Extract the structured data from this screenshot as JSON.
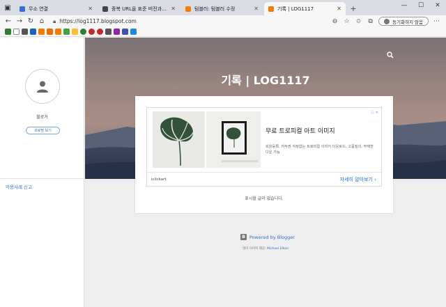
{
  "browser": {
    "tabs": [
      {
        "title": "무소 연결",
        "favicon_color": "#2f6fd6",
        "active": false
      },
      {
        "title": "중복 URL을 표준 버전과 통합 | Googl",
        "favicon_color": "#444444",
        "active": false
      },
      {
        "title": "텀블러: 텀블러 수정",
        "favicon_color": "#f57c00",
        "active": false
      },
      {
        "title": "기록 | LOG1117",
        "favicon_color": "#f57c00",
        "active": true
      }
    ],
    "url": "https://log1117.blogspot.com",
    "sync_label": "동기화하지 않음",
    "bookmark_colors": [
      "#2e7d32",
      "#666666",
      "#444444",
      "#1565c0",
      "#f57c00",
      "#ef6c00",
      "#f57c00",
      "#43a047",
      "#fbc02d",
      "#2e7d32",
      "#c62828",
      "#c62828",
      "#444444",
      "#8e24aa",
      "#3f51b5",
      "#1e88e5"
    ]
  },
  "sidebar": {
    "profile_name": "블로거",
    "profile_button": "프로필 보기",
    "report_link": "악용사례 신고"
  },
  "blog": {
    "title": "기록 | LOG1117",
    "no_posts": "표시할 글이 없습니다.",
    "powered_by": "Powered by Blogger",
    "theme_prefix": "테마 이미지 제공: ",
    "theme_author": "Michael Elkan"
  },
  "ad": {
    "badge": "ⓘ ✕",
    "title": "무료 트로피컬 아트 이미지",
    "description": "회원등록, 저작권 걱정없는 트로피컬 이미지 다운로드, 고품질의, 무제한 다운 가능",
    "source": "iclickart",
    "cta": "자세히 알아보기"
  }
}
